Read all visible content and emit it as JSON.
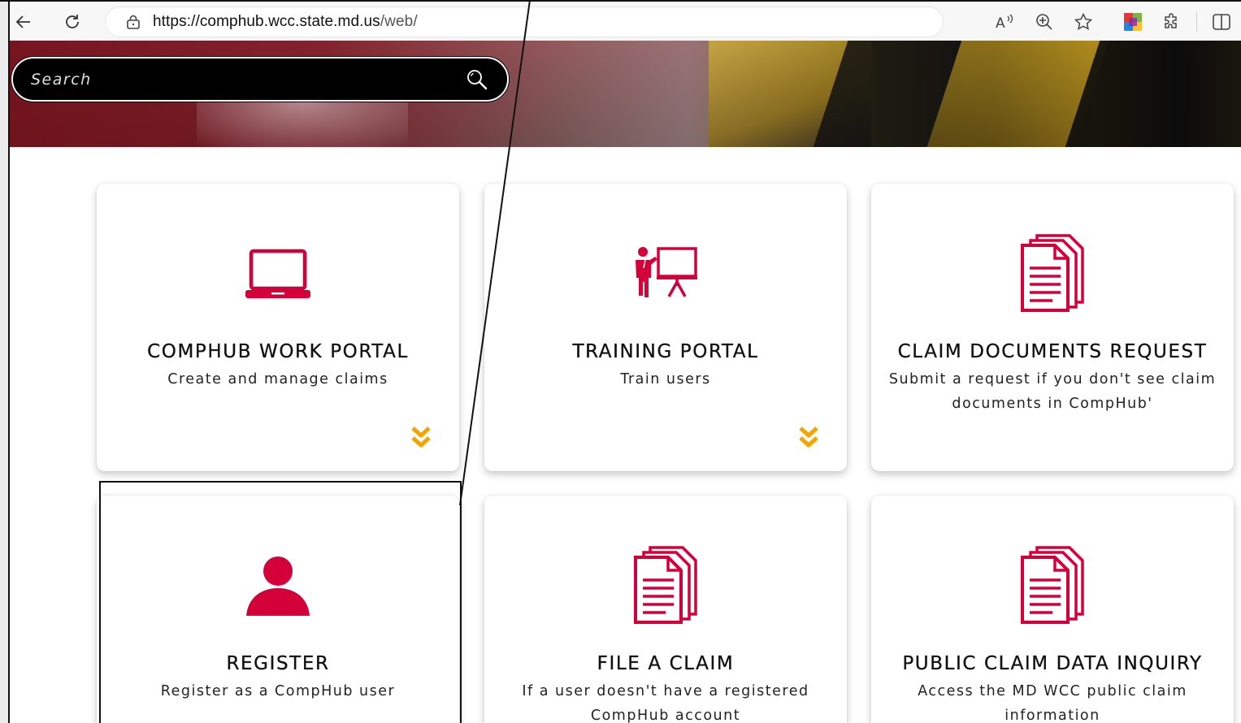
{
  "browser": {
    "url_host": "https://comphub.wcc.state.md.us",
    "url_path": "/web/"
  },
  "search": {
    "placeholder": "Search"
  },
  "cards": [
    {
      "title": "COMPHUB WORK PORTAL",
      "description": "Create and manage claims",
      "icon": "laptop-icon"
    },
    {
      "title": "TRAINING PORTAL",
      "description": "Train users",
      "icon": "presenter-icon"
    },
    {
      "title": "CLAIM DOCUMENTS REQUEST",
      "description": "Submit a request if you don't see claim documents in CompHub'",
      "icon": "documents-icon"
    },
    {
      "title": "REGISTER",
      "description": "Register as a CompHub user",
      "icon": "user-icon"
    },
    {
      "title": "FILE A CLAIM",
      "description": "If a user doesn't have a registered CompHub account",
      "icon": "documents-icon"
    },
    {
      "title": "PUBLIC CLAIM DATA INQUIRY",
      "description": "Access the MD WCC public claim information",
      "icon": "documents-icon"
    }
  ],
  "colors": {
    "accent_red": "#d4003a",
    "chevron_orange": "#f5a300"
  }
}
